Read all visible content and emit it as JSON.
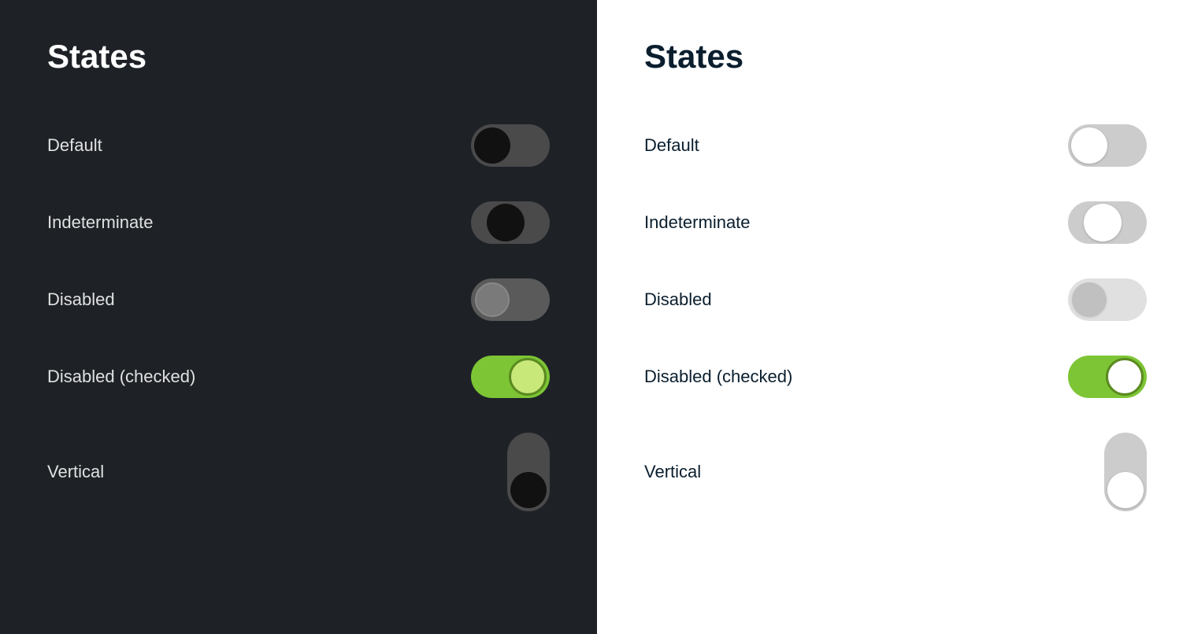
{
  "dark_panel": {
    "title": "States",
    "rows": [
      {
        "id": "default",
        "label": "Default"
      },
      {
        "id": "indeterminate",
        "label": "Indeterminate"
      },
      {
        "id": "disabled",
        "label": "Disabled"
      },
      {
        "id": "disabled-checked",
        "label": "Disabled (checked)"
      },
      {
        "id": "vertical",
        "label": "Vertical"
      }
    ]
  },
  "light_panel": {
    "title": "States",
    "rows": [
      {
        "id": "default",
        "label": "Default"
      },
      {
        "id": "indeterminate",
        "label": "Indeterminate"
      },
      {
        "id": "disabled",
        "label": "Disabled"
      },
      {
        "id": "disabled-checked",
        "label": "Disabled (checked)"
      },
      {
        "id": "vertical",
        "label": "Vertical"
      }
    ]
  }
}
